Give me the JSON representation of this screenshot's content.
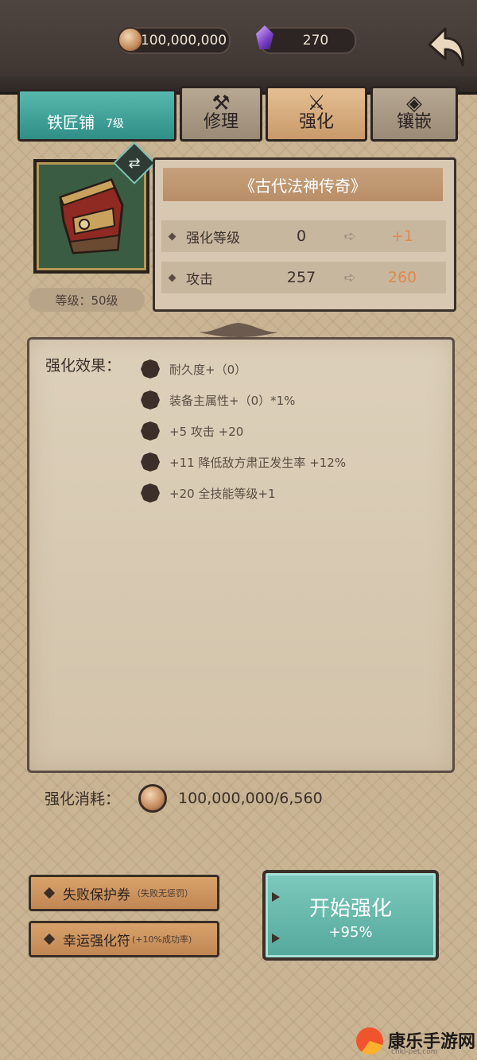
{
  "resources": {
    "coins": "100,000,000",
    "gems": "270"
  },
  "tabs": {
    "shop_name": "铁匠铺",
    "shop_level": "7级",
    "repair": "修理",
    "enhance": "强化",
    "inlay": "镶嵌",
    "active": "enhance"
  },
  "item": {
    "name": "《古代法神传奇》",
    "level_label": "等级：50级"
  },
  "stats": [
    {
      "label": "强化等级",
      "from": "0",
      "to": "+1"
    },
    {
      "label": "攻击",
      "from": "257",
      "to": "260"
    }
  ],
  "effects": {
    "title": "强化效果：",
    "items": [
      "耐久度+（0）",
      "装备主属性+（0）*1%",
      "+5  攻击 +20",
      "+11  降低敌方肃正发生率 +12%",
      "+20  全技能等级+1"
    ]
  },
  "cost": {
    "label": "强化消耗：",
    "value": "100,000,000/6,560"
  },
  "buttons": {
    "protect_main": "失败保护券",
    "protect_sub": "（失败无惩罚）",
    "lucky_main": "幸运强化符",
    "lucky_sub": "(+10%成功率)",
    "start_main": "开始强化",
    "start_sub": "+95%"
  },
  "watermark": {
    "name": "康乐手游网",
    "url": "chkl-pet.com"
  },
  "colors": {
    "accent_teal": "#55a89c",
    "upgrade_orange": "#e0894b",
    "panel_parchment": "#d2c3aa"
  }
}
